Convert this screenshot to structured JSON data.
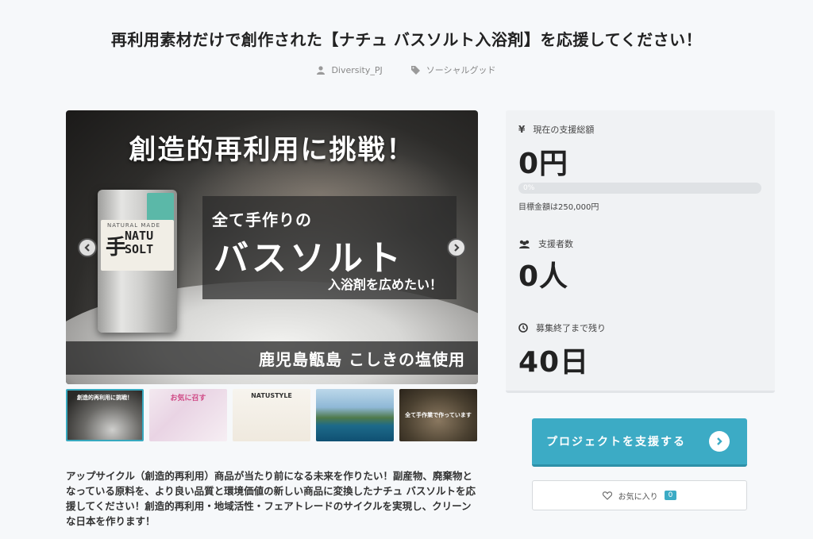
{
  "page": {
    "title": "再利用素材だけで創作された【ナチュ バスソルト入浴剤】を応援してください！",
    "author": "Diversity_PJ",
    "category": "ソーシャルグッド"
  },
  "slide": {
    "headline": "創造的再利用に挑戦！",
    "line1": "全て手作りの",
    "line2": "バスソルト",
    "line3": "入浴剤を広めたい！",
    "footer": "鹿児島甑島 こしきの塩使用",
    "package_brand": "NATU\nSOLT",
    "package_mark": "手",
    "package_caption": "NATURAL MADE"
  },
  "thumbnails": [
    {
      "caption": "創造的再利用に挑戦！"
    },
    {
      "caption": "お気に召す"
    },
    {
      "caption": "NATUSTYLE"
    },
    {
      "caption": ""
    },
    {
      "caption": "全て手作業で作っています"
    }
  ],
  "description": "アップサイクル（創造的再利用）商品が当たり前になる未来を作りたい！副産物、廃棄物となっている原料を、より良い品質と環境価値の新しい商品に変換したナチュ バスソルトを応援してください！創造的再利用・地域活性・フェアトレードのサイクルを実現し、クリーンな日本を作ります！",
  "stats": {
    "total_label": "現在の支援総額",
    "total_value": "0円",
    "progress_text": "0%",
    "progress": 0,
    "goal_text": "目標金額は250,000円",
    "backers_label": "支援者数",
    "backers_value": "0人",
    "remaining_label": "募集終了まで残り",
    "remaining_value": "40日",
    "yen_symbol": "¥"
  },
  "actions": {
    "support_label": "プロジェクトを支援する",
    "favorite_label": "お気に入り",
    "favorite_count": "0"
  },
  "colors": {
    "accent": "#3cabc5"
  }
}
